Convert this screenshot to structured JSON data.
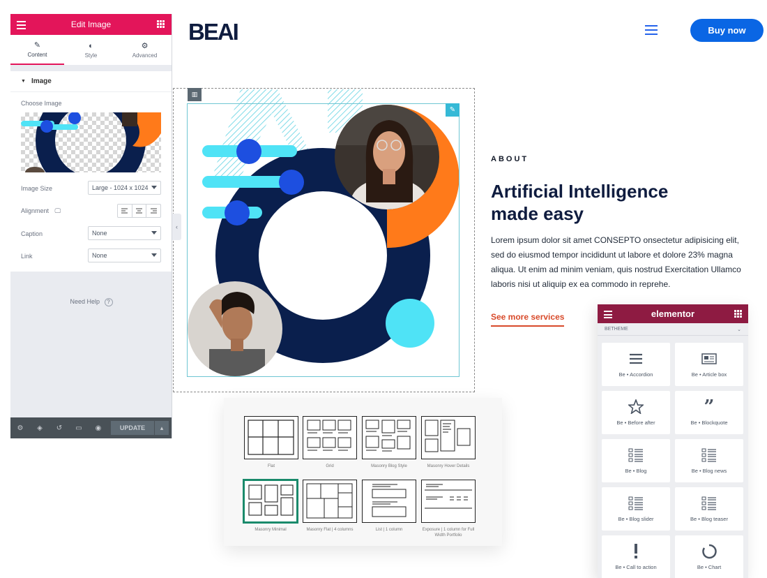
{
  "header": {
    "logo_text": "BEAI",
    "menu_icon": "hamburger-icon",
    "buy_now_label": "Buy now"
  },
  "editor": {
    "title": "Edit Image",
    "tabs": [
      {
        "label": "Content",
        "icon": "pencil-icon",
        "active": true
      },
      {
        "label": "Style",
        "icon": "half-circle-icon",
        "active": false
      },
      {
        "label": "Advanced",
        "icon": "gear-icon",
        "active": false
      }
    ],
    "section_title": "Image",
    "choose_image_label": "Choose Image",
    "image_size": {
      "label": "Image Size",
      "value": "Large - 1024 x 1024"
    },
    "alignment": {
      "label": "Alignment"
    },
    "caption": {
      "label": "Caption",
      "value": "None"
    },
    "link": {
      "label": "Link",
      "value": "None"
    },
    "need_help": "Need Help",
    "update_label": "UPDATE"
  },
  "about": {
    "eyebrow": "ABOUT",
    "title_line1": "Artificial Intelligence",
    "title_line2": "made easy",
    "body": "Lorem ipsum dolor sit amet CONSEPTO onsectetur adipisicing elit, sed do eiusmod tempor incididunt ut labore et dolore 23% magna aliqua. Ut enim ad minim veniam, quis nostrud Exercitation Ullamco laboris nisi ut aliquip ex ea commodo in reprehe.",
    "link_label": "See more services"
  },
  "layouts": [
    {
      "label": "Flat",
      "selected": false
    },
    {
      "label": "Grid",
      "selected": false
    },
    {
      "label": "Masonry Blog Style",
      "selected": false
    },
    {
      "label": "Masonry Hover Details",
      "selected": false
    },
    {
      "label": "Masonry Minimal",
      "selected": true
    },
    {
      "label": "Masonry Flat | 4 columns",
      "selected": false
    },
    {
      "label": "List | 1 column",
      "selected": false
    },
    {
      "label": "Exposure | 1 column for Full Width Portfolio",
      "selected": false
    }
  ],
  "widgets": {
    "brand": "elementor",
    "category": "BETHEME",
    "items": [
      {
        "label": "Be • Accordion",
        "icon": "accordion-icon"
      },
      {
        "label": "Be • Article box",
        "icon": "article-box-icon"
      },
      {
        "label": "Be • Before after",
        "icon": "star-icon"
      },
      {
        "label": "Be • Blockquote",
        "icon": "quote-icon"
      },
      {
        "label": "Be • Blog",
        "icon": "blog-list-icon"
      },
      {
        "label": "Be • Blog news",
        "icon": "blog-list-icon"
      },
      {
        "label": "Be • Blog slider",
        "icon": "blog-list-icon"
      },
      {
        "label": "Be • Blog teaser",
        "icon": "blog-list-icon"
      },
      {
        "label": "Be • Call to action",
        "icon": "exclamation-icon"
      },
      {
        "label": "Be • Chart",
        "icon": "chart-ring-icon"
      }
    ]
  },
  "colors": {
    "accent_pink": "#e3155a",
    "brand_navy": "#0f1c3f",
    "cyan": "#4fe3f6",
    "blue": "#1d4fe0",
    "orange": "#ff7a1a",
    "buy_blue": "#0a66e4",
    "elementor_maroon": "#8e1b42",
    "link_red": "#d84a2a"
  }
}
